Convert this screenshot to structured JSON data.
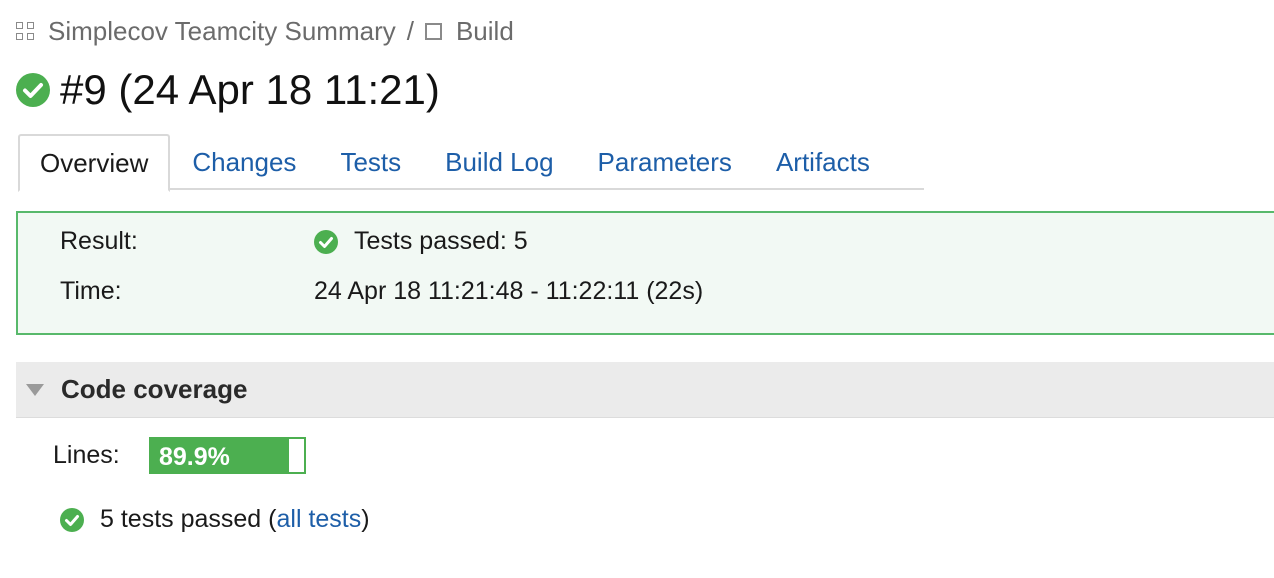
{
  "breadcrumb": {
    "project": "Simplecov Teamcity Summary",
    "separator": "/",
    "build_config": "Build",
    "project_icon": "grid-icon",
    "build_icon": "square-icon"
  },
  "title": {
    "text": "#9 (24 Apr 18 11:21)",
    "status_icon": "check-circle-icon"
  },
  "tabs": [
    {
      "label": "Overview",
      "active": true
    },
    {
      "label": "Changes"
    },
    {
      "label": "Tests"
    },
    {
      "label": "Build Log"
    },
    {
      "label": "Parameters"
    },
    {
      "label": "Artifacts"
    }
  ],
  "summary": {
    "result_label": "Result:",
    "result_value": "Tests passed: 5",
    "time_label": "Time:",
    "time_value": "24 Apr 18 11:21:48 - 11:22:11 (22s)"
  },
  "coverage": {
    "title": "Code coverage",
    "lines_label": "Lines:",
    "lines_value": "89.9%",
    "lines_fraction": 0.899
  },
  "tests": {
    "summary": "5 tests passed",
    "open_paren": " (",
    "link": "all tests",
    "close_paren": ")"
  },
  "colors": {
    "success": "#4caf50",
    "link": "#1d5ea8",
    "result_bg": "#f2f9f4",
    "result_border": "#58b96b"
  }
}
